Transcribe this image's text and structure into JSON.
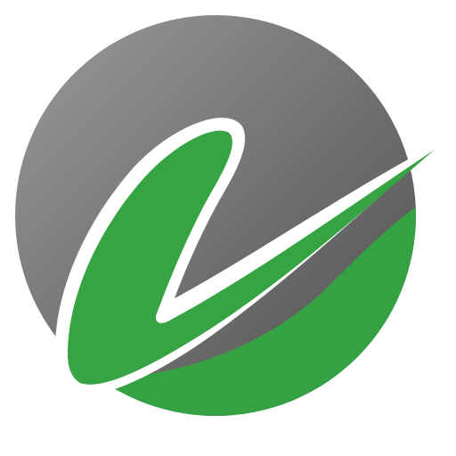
{
  "logo": {
    "icon_name": "v-checkmark-logo-icon",
    "colors": {
      "background": "#ffffff",
      "circle_gray_light": "#9a9a9a",
      "circle_gray_dark": "#4d4d4d",
      "circle_green": "#34a242",
      "mark_green": "#36a443",
      "mark_outline": "#ffffff"
    }
  }
}
